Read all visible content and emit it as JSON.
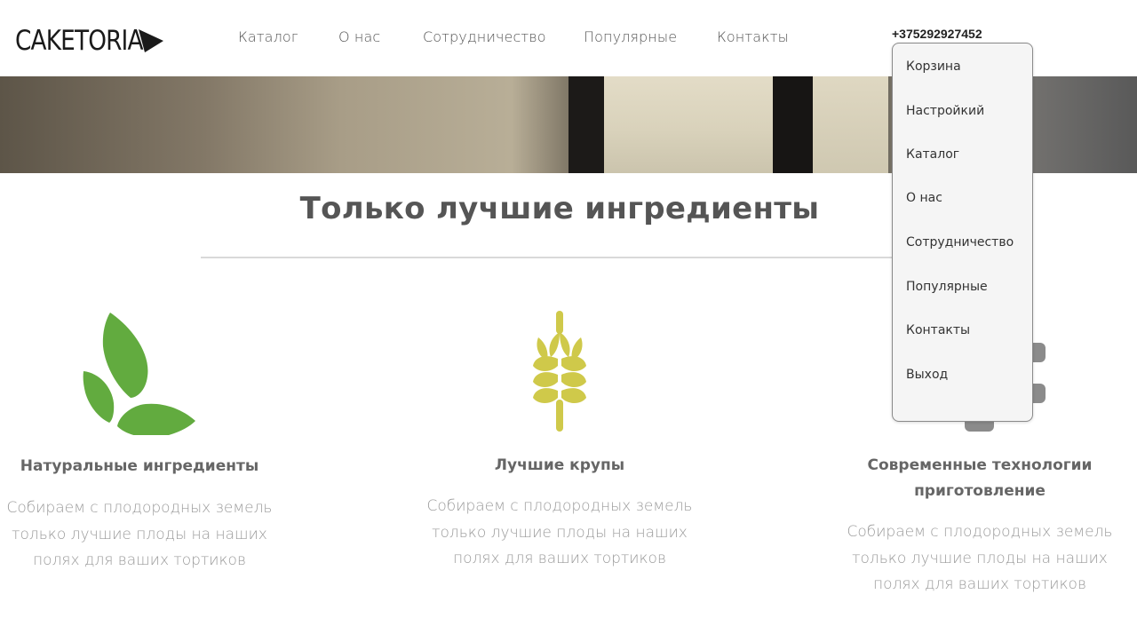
{
  "header": {
    "logo_text": "CAKETORIA",
    "nav": [
      "Каталог",
      "О нас",
      "Сотрудничество",
      "Популярные",
      "Контакты"
    ],
    "phone": "+375292927452"
  },
  "dropdown": {
    "items": [
      "Корзина",
      "Настройкий",
      "Каталог",
      "О нас",
      "Сотрудничество",
      "Популярные",
      "Контакты",
      "Выход"
    ]
  },
  "section": {
    "title": "Только лучшие ингредиенты"
  },
  "features": [
    {
      "icon": "leaves-icon",
      "title": "Натуральные ингредиенты",
      "lines": [
        "Собираем с плодородных земель",
        "только лучшие плоды на наших",
        "полях для ваших тортиков"
      ]
    },
    {
      "icon": "wheat-icon",
      "title": "Лучшие крупы",
      "lines": [
        "Собираем с плодородных земель",
        "только лучшие плоды на наших",
        "полях для ваших тортиков"
      ]
    },
    {
      "icon": "technology-icon",
      "title_lines": [
        "Современные технологии",
        "приготовление"
      ],
      "lines": [
        "Собираем с плодородных земель",
        "только лучшие плоды на наших",
        "полях для ваших тортиков"
      ]
    }
  ],
  "colors": {
    "leaf_green": "#62ab3f",
    "wheat_yellow": "#cfc94a"
  }
}
